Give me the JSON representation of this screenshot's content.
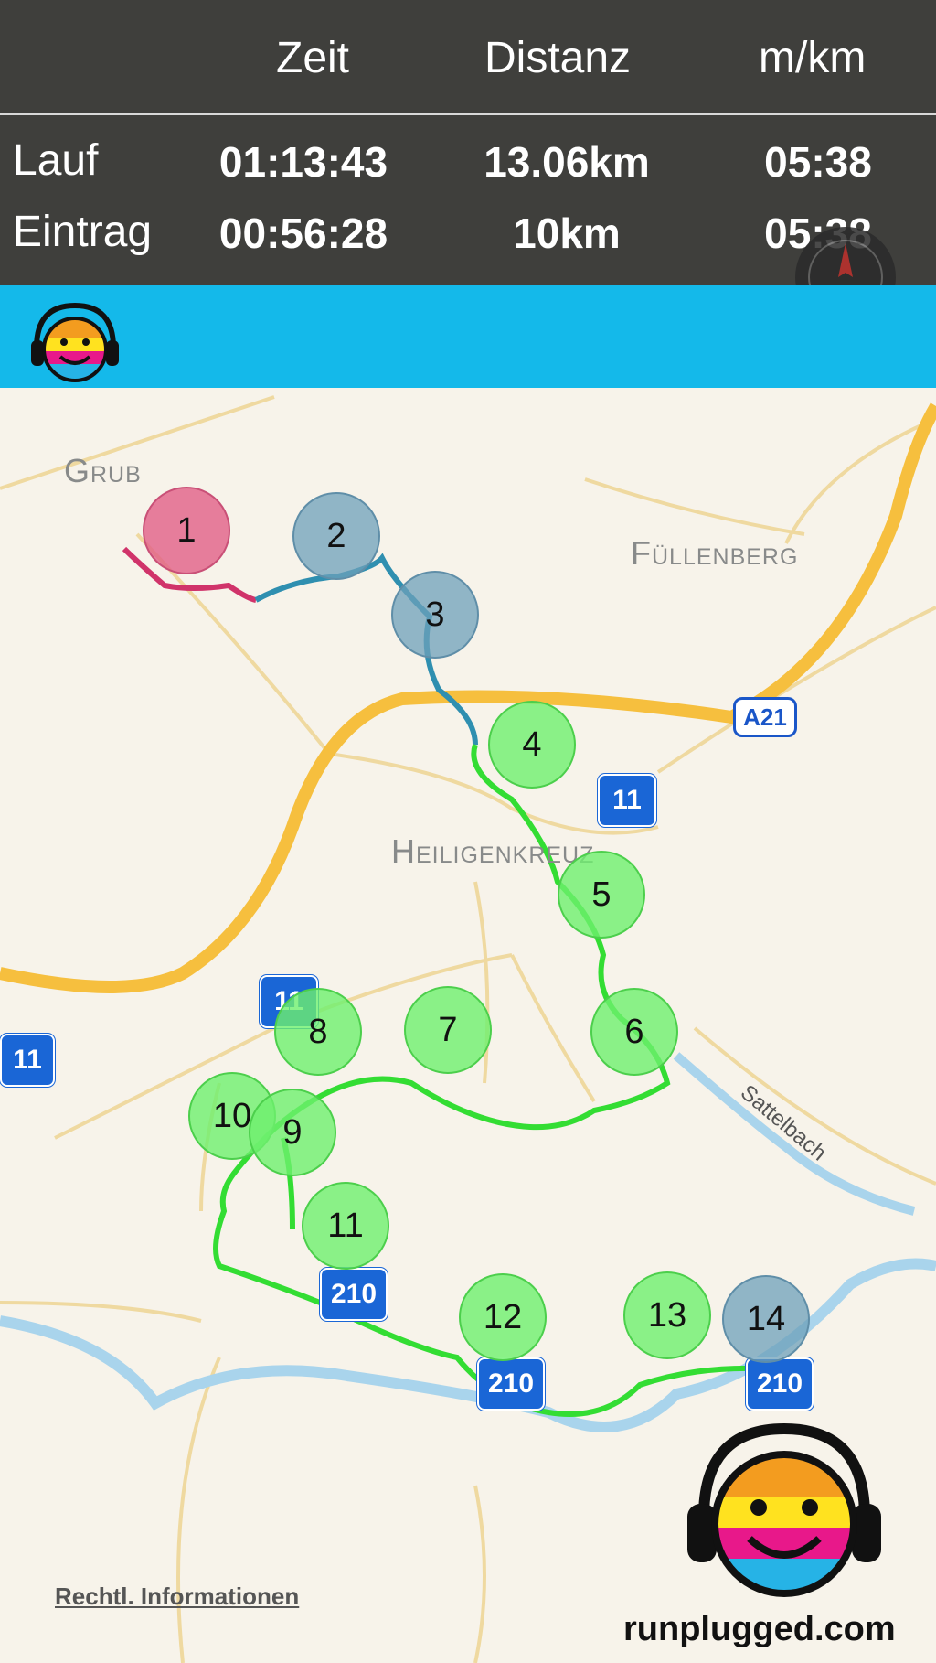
{
  "stats": {
    "headers": {
      "time": "Zeit",
      "distance": "Distanz",
      "pace": "m/km"
    },
    "rows": [
      {
        "label": "Lauf",
        "time": "01:13:43",
        "distance": "13.06km",
        "pace": "05:38"
      },
      {
        "label": "Eintrag",
        "time": "00:56:28",
        "distance": "10km",
        "pace": "05:38"
      }
    ]
  },
  "map": {
    "places": [
      "Grub",
      "Füllenberg",
      "Heiligenkreuz"
    ],
    "road_label": "Sattelbach",
    "shields": {
      "b11": "11",
      "a21": "A21",
      "b210": "210"
    },
    "markers": [
      "1",
      "2",
      "3",
      "4",
      "5",
      "6",
      "7",
      "8",
      "9",
      "10",
      "11",
      "12",
      "13",
      "14"
    ],
    "legal": "Rechtl. Informationen"
  },
  "footer": {
    "site": "runplugged.com"
  },
  "icons": [
    "runplugged-logo-icon",
    "compass-icon"
  ],
  "colors": {
    "brand_bar": "#14b9ea",
    "route_start": "#d0336a",
    "route_mid": "#2f8fb0",
    "route_main": "#33dd33"
  }
}
